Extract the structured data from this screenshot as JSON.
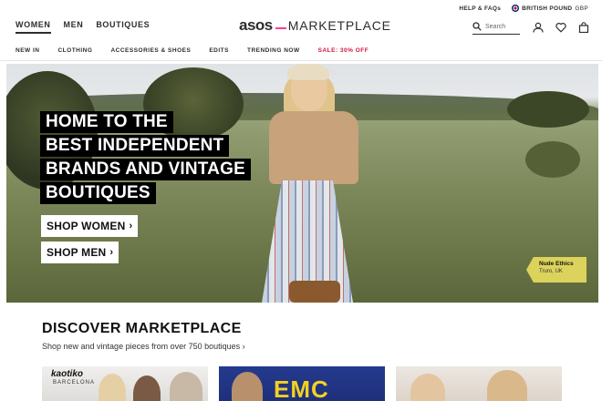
{
  "header": {
    "gender_tabs": [
      "WOMEN",
      "MEN",
      "BOUTIQUES"
    ],
    "logo_brand": "asos",
    "logo_product": "MARKETPLACE",
    "help_link": "HELP & FAQs",
    "country": "BRITISH POUND",
    "currency": "GBP",
    "search_placeholder": "Search"
  },
  "category_nav": [
    "NEW IN",
    "CLOTHING",
    "ACCESSORIES & SHOES",
    "EDITS",
    "TRENDING NOW",
    "SALE: 30% OFF"
  ],
  "hero": {
    "headline": [
      "HOME TO THE",
      "BEST INDEPENDENT",
      "BRANDS AND VINTAGE",
      "BOUTIQUES"
    ],
    "cta_women": "SHOP WOMEN",
    "cta_men": "SHOP MEN",
    "tag_brand": "Nude Ethics",
    "tag_location": "Truro, UK"
  },
  "discover": {
    "title": "DISCOVER MARKETPLACE",
    "subtitle": "Shop new and vintage pieces from over 750 boutiques ›",
    "tiles": [
      {
        "brand": "kaotiko",
        "sub": "BARCELONA"
      },
      {
        "brand": "EMC"
      },
      {
        "brand": ""
      }
    ]
  },
  "colors": {
    "accent_pink": "#ff3c8e",
    "sale_red": "#d01345",
    "text_dark": "#2d2d2d"
  }
}
